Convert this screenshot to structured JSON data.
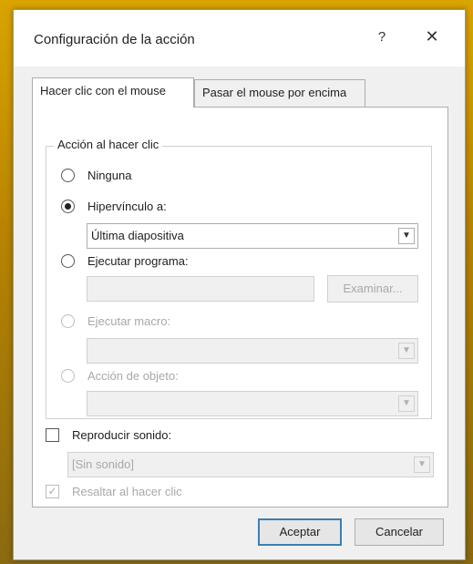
{
  "dialog": {
    "title": "Configuración de la acción",
    "help_label": "?",
    "close_label": "✕"
  },
  "tabs": [
    {
      "label": "Hacer clic con el mouse",
      "active": true
    },
    {
      "label": "Pasar el mouse por encima",
      "active": false
    }
  ],
  "action_group": {
    "legend": "Acción al hacer clic",
    "options": [
      {
        "label": "Ninguna",
        "checked": false,
        "enabled": true
      },
      {
        "label": "Hipervínculo a:",
        "checked": true,
        "enabled": true
      },
      {
        "label": "Ejecutar programa:",
        "checked": false,
        "enabled": true
      },
      {
        "label": "Ejecutar macro:",
        "checked": false,
        "enabled": false
      },
      {
        "label": "Acción de objeto:",
        "checked": false,
        "enabled": false
      }
    ],
    "hyperlink_select_value": "Última diapositiva",
    "program_path_value": "",
    "browse_label": "Examinar...",
    "macro_select_value": "",
    "object_action_select_value": ""
  },
  "sound": {
    "checkbox_label": "Reproducir sonido:",
    "checked": false,
    "select_value": "[Sin sonido]"
  },
  "highlight": {
    "checkbox_label": "Resaltar al hacer clic",
    "checked": true,
    "check_glyph": "✓"
  },
  "footer": {
    "accept_label": "Aceptar",
    "cancel_label": "Cancelar"
  },
  "icons": {
    "dropdown_arrow": "chevron-down-icon"
  }
}
